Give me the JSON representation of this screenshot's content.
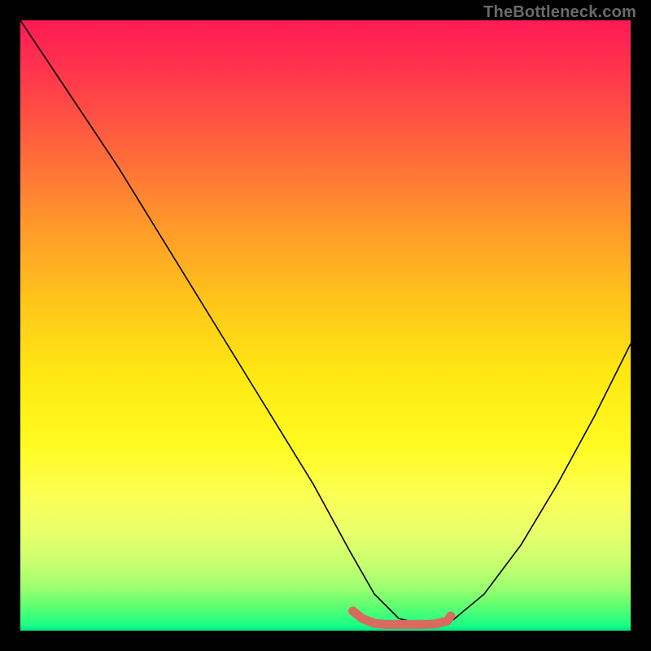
{
  "watermark": "TheBottleneck.com",
  "chart_data": {
    "type": "line",
    "title": "",
    "xlabel": "",
    "ylabel": "",
    "xlim": [
      0,
      100
    ],
    "ylim": [
      0,
      100
    ],
    "grid": false,
    "legend": false,
    "background_gradient": {
      "orientation": "vertical",
      "stops": [
        {
          "pos": 0,
          "color": "#ff1a55"
        },
        {
          "pos": 50,
          "color": "#ffd520"
        },
        {
          "pos": 80,
          "color": "#fcff4a"
        },
        {
          "pos": 100,
          "color": "#00e886"
        }
      ]
    },
    "series": [
      {
        "name": "bottleneck-curve",
        "color": "#000000",
        "stroke_width": 1.6,
        "x": [
          0,
          8,
          16,
          24,
          32,
          40,
          48,
          54,
          58,
          62,
          66,
          70,
          76,
          82,
          88,
          94,
          100
        ],
        "values": [
          100,
          88,
          76,
          63,
          50,
          37,
          24,
          13,
          6,
          2,
          1,
          1,
          6,
          14,
          24,
          35,
          47
        ]
      },
      {
        "name": "optimal-zone-highlight",
        "color": "#d86a60",
        "stroke_width": 11,
        "stroke_linecap": "round",
        "x": [
          54.5,
          56,
          58,
          60,
          62,
          64,
          66,
          68,
          70,
          70.5
        ],
        "values": [
          3.2,
          2.0,
          1.2,
          1.0,
          1.0,
          1.0,
          1.0,
          1.1,
          1.6,
          2.4
        ]
      }
    ],
    "annotations": []
  }
}
